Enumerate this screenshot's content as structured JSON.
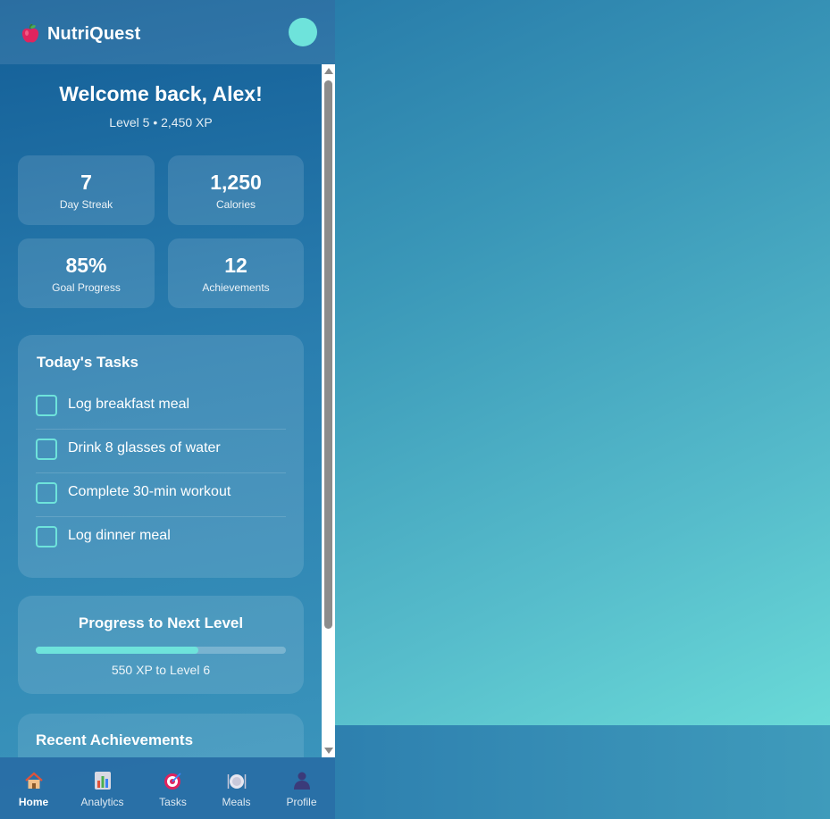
{
  "app": {
    "title": "NutriQuest"
  },
  "welcome": {
    "heading": "Welcome back, Alex!",
    "level_line": "Level 5 • 2,450 XP"
  },
  "stats": [
    {
      "value": "7",
      "label": "Day Streak"
    },
    {
      "value": "1,250",
      "label": "Calories"
    },
    {
      "value": "85%",
      "label": "Goal Progress"
    },
    {
      "value": "12",
      "label": "Achievements"
    }
  ],
  "tasks": {
    "title": "Today's Tasks",
    "items": [
      {
        "label": "Log breakfast meal",
        "checked": false
      },
      {
        "label": "Drink 8 glasses of water",
        "checked": false
      },
      {
        "label": "Complete 30-min workout",
        "checked": false
      },
      {
        "label": "Log dinner meal",
        "checked": false
      }
    ]
  },
  "progress": {
    "title": "Progress to Next Level",
    "fraction": 0.65,
    "note": "550 XP to Level 6"
  },
  "achievements": {
    "title": "Recent Achievements"
  },
  "nav": [
    {
      "label": "Home",
      "icon": "house-icon",
      "active": true
    },
    {
      "label": "Analytics",
      "icon": "bar-chart-icon",
      "active": false
    },
    {
      "label": "Tasks",
      "icon": "target-icon",
      "active": false
    },
    {
      "label": "Meals",
      "icon": "plate-icon",
      "active": false
    },
    {
      "label": "Profile",
      "icon": "person-icon",
      "active": false
    }
  ],
  "colors": {
    "accent": "#6ee3db",
    "header_bg": "#135e97"
  }
}
